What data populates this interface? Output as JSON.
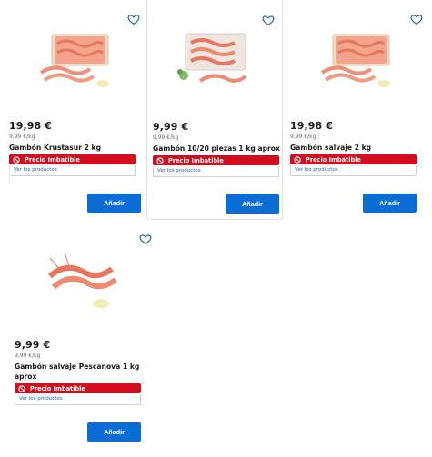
{
  "products": [
    {
      "price": "19,98 €",
      "unit_price": "9,99 €/kg",
      "name": "Gambón Krustasur 2 kg",
      "badge": "Precio Imbatible",
      "see_products": "Ver los productos",
      "add_label": "Añadir"
    },
    {
      "price": "9,99 €",
      "unit_price": "9,99 €/kg",
      "name": "Gambón 10/20 piezas 1 kg aprox",
      "badge": "Precio Imbatible",
      "see_products": "Ver los productos",
      "add_label": "Añadir"
    },
    {
      "price": "19,98 €",
      "unit_price": "9,99 €/kg",
      "name": "Gambón salvaje 2 kg",
      "badge": "Precio Imbatible",
      "see_products": "Ver los productos",
      "add_label": "Añadir"
    },
    {
      "price": "9,99 €",
      "unit_price": "9,99 €/kg",
      "name": "Gambón salvaje Pescanova 1 kg aprox",
      "badge": "Precio Imbatible",
      "see_products": "Ver los productos",
      "add_label": "Añadir"
    }
  ],
  "icons": {
    "favorite": "heart-outline-icon",
    "badge": "ban-icon"
  },
  "colors": {
    "badge_red": "#d30d1d",
    "button_blue": "#0a6dd6",
    "link_blue": "#1a63b4",
    "heart_blue": "#1a63b4"
  }
}
